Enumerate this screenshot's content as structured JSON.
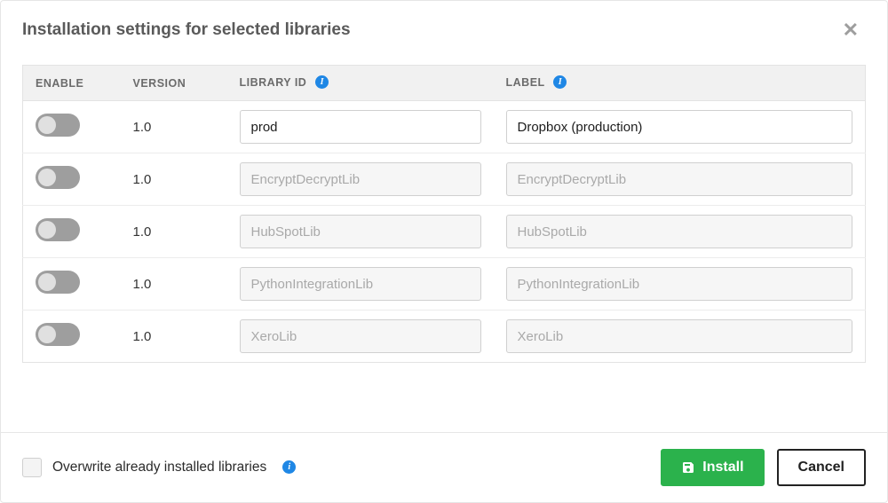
{
  "header": {
    "title": "Installation settings for selected libraries"
  },
  "columns": {
    "enable": "Enable",
    "version": "Version",
    "library_id": "Library ID",
    "label": "Label"
  },
  "rows": [
    {
      "enabled": false,
      "version": "1.0",
      "library_id": "prod",
      "label": "Dropbox (production)",
      "editable": true
    },
    {
      "enabled": false,
      "version": "1.0",
      "library_id": "EncryptDecryptLib",
      "label": "EncryptDecryptLib",
      "editable": false
    },
    {
      "enabled": false,
      "version": "1.0",
      "library_id": "HubSpotLib",
      "label": "HubSpotLib",
      "editable": false
    },
    {
      "enabled": false,
      "version": "1.0",
      "library_id": "PythonIntegrationLib",
      "label": "PythonIntegrationLib",
      "editable": false
    },
    {
      "enabled": false,
      "version": "1.0",
      "library_id": "XeroLib",
      "label": "XeroLib",
      "editable": false
    }
  ],
  "footer": {
    "overwrite_label": "Overwrite already installed libraries",
    "overwrite_checked": false,
    "install_label": "Install",
    "cancel_label": "Cancel"
  },
  "icons": {
    "info": "i",
    "close": "✕"
  }
}
